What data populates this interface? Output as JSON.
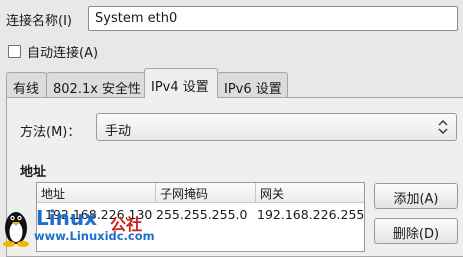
{
  "connection": {
    "name_label": "连接名称(I)",
    "name_value": "System eth0",
    "auto_connect_label": "自动连接(A)",
    "auto_connect_checked": false
  },
  "tabs": [
    {
      "label": "有线",
      "active": false
    },
    {
      "label": "802.1x 安全性",
      "active": false
    },
    {
      "label": "IPv4 设置",
      "active": true
    },
    {
      "label": "IPv6 设置",
      "active": false
    }
  ],
  "ipv4": {
    "method_label": "方法(M)：",
    "method_value": "手动",
    "address_heading": "地址",
    "columns": [
      "地址",
      "子网掩码",
      "网关"
    ],
    "rows": [
      {
        "address": "192.168.226.130",
        "netmask": "255.255.255.0",
        "gateway": "192.168.226.255"
      }
    ],
    "add_button": "添加(A)",
    "delete_button": "删除(D)"
  },
  "watermark": {
    "brand": "Linux",
    "brand_cn": "公社",
    "url": "www.Linuxidc.com"
  },
  "colors": {
    "watermark_blue": "#1e6fc9",
    "watermark_red": "#d42020",
    "window_bg": "#e8e8e7"
  }
}
